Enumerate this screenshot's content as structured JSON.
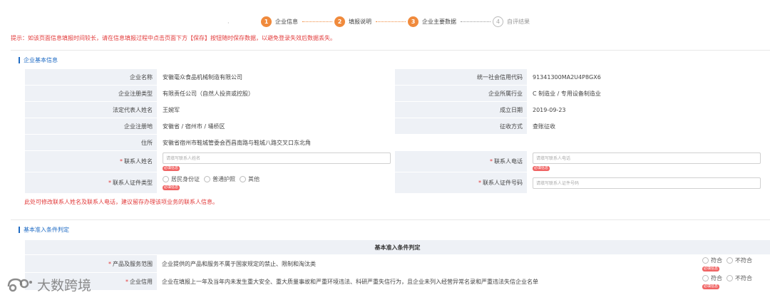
{
  "stepper": {
    "dot": "·",
    "steps": [
      {
        "num": "1",
        "label": "企业信息"
      },
      {
        "num": "2",
        "label": "填报说明"
      },
      {
        "num": "3",
        "label": "企业主要数据"
      },
      {
        "num": "4",
        "label": "自评结果"
      }
    ],
    "active_color": "#f08a3c"
  },
  "tip": "提示：如该页面信息填报时间较长，请在信息填报过程中点击页面下方【保存】按钮随时保存数据，以避免登录失效后数据丢失。",
  "basic": {
    "title": "企业基本信息",
    "name_label": "企业名称",
    "name_value": "安徽毫众食品机械制造有限公司",
    "credit_label": "统一社会信用代码",
    "credit_value": "91341300MA2U4P8GX6",
    "type_label": "企业注册类型",
    "type_value": "有限责任公司（自然人投资或控股）",
    "industry_label": "企业所属行业",
    "industry_value": "C 制造业 / 专用设备制造业",
    "rep_label": "法定代表人姓名",
    "rep_value": "王婉军",
    "date_label": "成立日期",
    "date_value": "2019-09-23",
    "reg_label": "企业注册地",
    "reg_value": "安徽省 / 宿州市 / 埇桥区",
    "tax_label": "征收方式",
    "tax_value": "查账征收",
    "addr_label": "住所",
    "addr_value": "安徽省宿州市鞋城管委会西昌南路与鞋城八路交叉口东北角",
    "contact_label": "联系人姓名",
    "contact_placeholder": "请填写联系人姓名",
    "phone_label": "联系人电话",
    "phone_placeholder": "请填写联系人电话",
    "idtype_label": "联系人证件类型",
    "idtype_options": [
      "居民身份证",
      "普通护照",
      "其他"
    ],
    "idno_label": "联系人证件号码",
    "idno_placeholder": "请填写联系人证件号码",
    "required_badge": "必填信息",
    "required_mark": "*"
  },
  "note": "此处可修改联系人姓名及联系人电话，建议留存办理该项业务的联系人信息。",
  "criteria": {
    "title": "基本准入条件判定",
    "header": "基本准入条件判定",
    "rows": [
      {
        "label": "产品及服务范围",
        "text": "企业提供的产品和服务不属于国家规定的禁止、限制和淘汰类",
        "yes": "符合",
        "no": "不符合"
      },
      {
        "label": "企业信用",
        "text": "企业在填报上一年及当年内未发生重大安全、重大质量事故和严重环境违法、科研严重失信行为，且企业未列入经营异常名录和严重违法失信企业名单",
        "yes": "符合",
        "no": "不符合"
      }
    ]
  },
  "watermark": "大数跨境"
}
